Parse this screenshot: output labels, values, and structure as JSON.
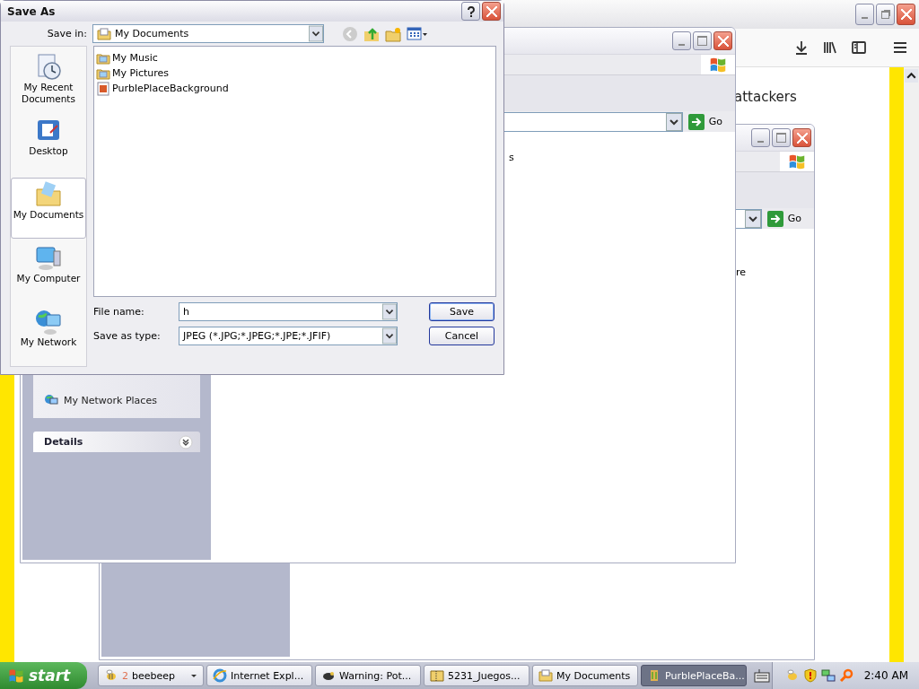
{
  "background_browser": {
    "content_text": "attackers"
  },
  "explorer_windows": [
    {
      "go_label": "Go",
      "content_fragment": "s",
      "sidebar_items": [
        "My Network Places"
      ],
      "details_title": "Details"
    },
    {
      "go_label": "Go",
      "content_fragment": "re"
    }
  ],
  "dialog": {
    "title": "Save As",
    "save_in_label": "Save in:",
    "save_in_value": "My Documents",
    "places": [
      {
        "label": "My Recent Documents",
        "kind": "recent",
        "selected": false
      },
      {
        "label": "Desktop",
        "kind": "desktop",
        "selected": false
      },
      {
        "label": "My Documents",
        "kind": "documents",
        "selected": true
      },
      {
        "label": "My Computer",
        "kind": "computer",
        "selected": false
      },
      {
        "label": "My Network",
        "kind": "network",
        "selected": false
      }
    ],
    "files": [
      {
        "name": "My Music",
        "kind": "folder"
      },
      {
        "name": "My Pictures",
        "kind": "folder"
      },
      {
        "name": "PurblePlaceBackground",
        "kind": "image"
      }
    ],
    "file_name_label": "File name:",
    "file_name_value": "h",
    "save_type_label": "Save as type:",
    "save_type_value": "JPEG (*.JPG;*.JPEG;*.JPE;*.JFIF)",
    "buttons": [
      "Save",
      "Cancel"
    ]
  },
  "taskbar": {
    "start_label": "start",
    "tasks": [
      {
        "label": "beebeep",
        "count": "2",
        "kind": "bee",
        "selected": false
      },
      {
        "label": "Internet Expl...",
        "kind": "browser",
        "selected": false
      },
      {
        "label": "Warning: Pot...",
        "kind": "creature",
        "selected": false
      },
      {
        "label": "5231_Juegos...",
        "kind": "zip",
        "selected": false
      },
      {
        "label": "My Documents",
        "kind": "folder",
        "selected": false
      },
      {
        "label": "PurblePlaceBa...",
        "kind": "image",
        "selected": true
      }
    ],
    "clock": "2:40 AM"
  }
}
